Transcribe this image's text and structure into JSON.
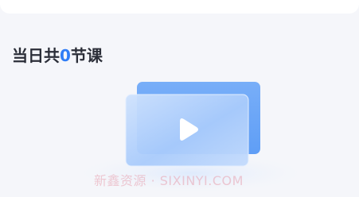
{
  "header": {
    "prefix": "当日共",
    "count": "0",
    "suffix": "节课"
  },
  "empty_state": {
    "icon": "video-play-icon"
  },
  "watermark": {
    "text": "新鑫资源 · SIXINYI.COM"
  },
  "colors": {
    "page_background": "#f5f6fa",
    "accent": "#2f7df6",
    "heading_text": "#2b2e38",
    "illustration_back": "#6ea8f8",
    "illustration_front": "#b6d3fb"
  }
}
